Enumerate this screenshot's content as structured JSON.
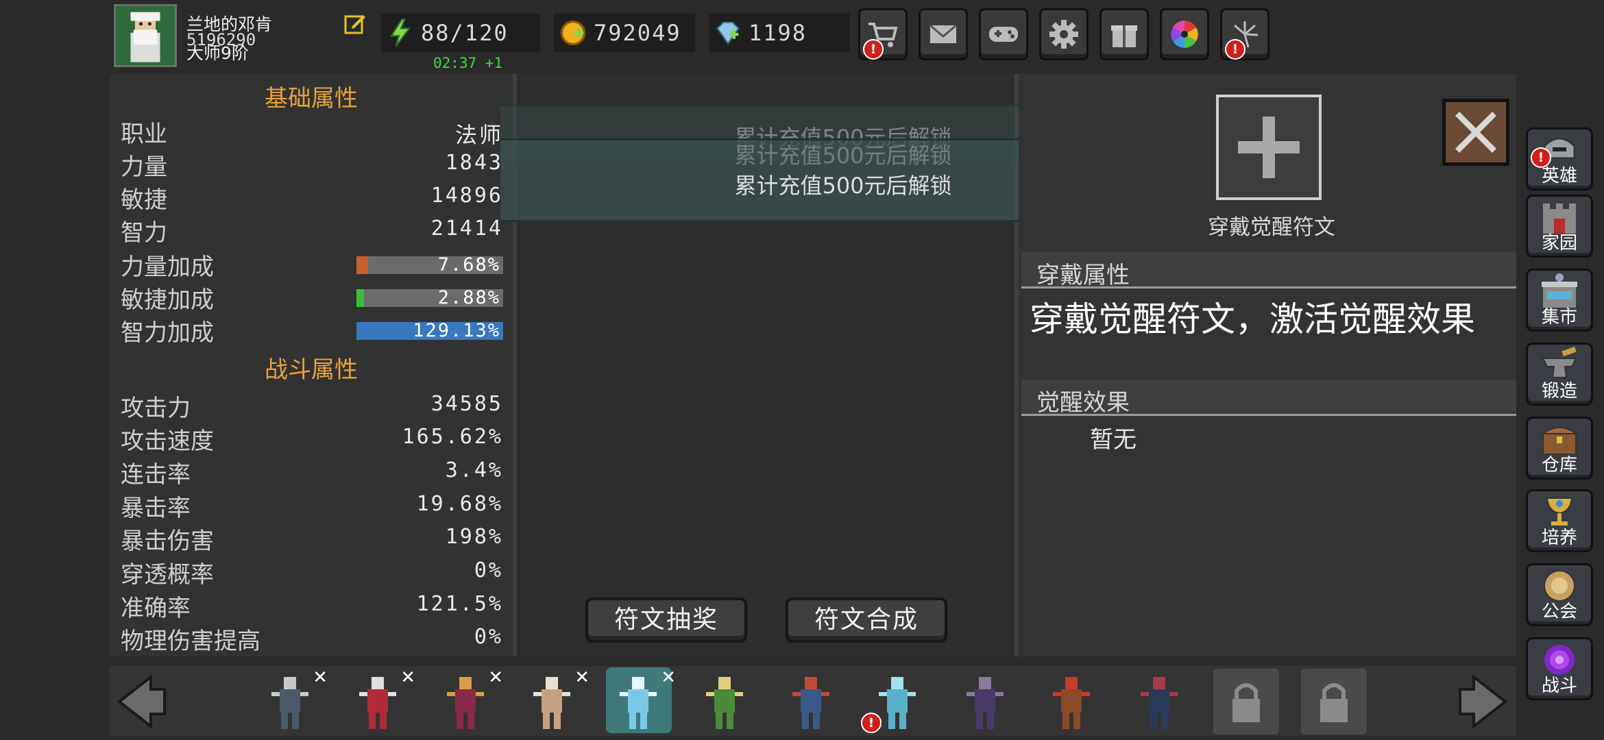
{
  "player": {
    "name": "兰地的邓肯",
    "id": "5196290",
    "rank": "大师9阶"
  },
  "resources": {
    "energy": "88/120",
    "energy_timer": "02:37 +1",
    "gold": "792049",
    "gems": "1198"
  },
  "top_buttons": [
    {
      "name": "shop",
      "icon": "cart-icon",
      "alert": "!"
    },
    {
      "name": "mail",
      "icon": "mail-icon"
    },
    {
      "name": "gamepad",
      "icon": "gamepad-icon"
    },
    {
      "name": "settings",
      "icon": "gear-icon"
    },
    {
      "name": "gift",
      "icon": "gift-icon"
    },
    {
      "name": "wheel",
      "icon": "color-wheel-icon"
    },
    {
      "name": "firework",
      "icon": "firework-icon",
      "alert": "!"
    }
  ],
  "base_attrs": {
    "title": "基础属性",
    "rows": [
      {
        "label": "职业",
        "value": "法师"
      },
      {
        "label": "力量",
        "value": "1843"
      },
      {
        "label": "敏捷",
        "value": "14896"
      },
      {
        "label": "智力",
        "value": "21414"
      }
    ],
    "bonus_rows": [
      {
        "label": "力量加成",
        "value": "7.68%",
        "fill": 0.08,
        "color": "#c8602c"
      },
      {
        "label": "敏捷加成",
        "value": "2.88%",
        "fill": 0.05,
        "color": "#34c234"
      },
      {
        "label": "智力加成",
        "value": "129.13%",
        "fill": 1.0,
        "color": "#3a78c0"
      }
    ]
  },
  "combat_attrs": {
    "title": "战斗属性",
    "rows": [
      {
        "label": "攻击力",
        "value": "34585"
      },
      {
        "label": "攻击速度",
        "value": "165.62%"
      },
      {
        "label": "连击率",
        "value": "3.4%"
      },
      {
        "label": "暴击率",
        "value": "19.68%"
      },
      {
        "label": "暴击伤害",
        "value": "198%"
      },
      {
        "label": "穿透概率",
        "value": "0%"
      },
      {
        "label": "准确率",
        "value": "121.5%"
      },
      {
        "label": "物理伤害提高",
        "value": "0%"
      }
    ]
  },
  "rune_panel": {
    "lock_text": "累计充值500元后解锁",
    "lottery_button": "符文抽奖",
    "synth_button": "符文合成"
  },
  "right_panel": {
    "slot_label": "穿戴觉醒符文",
    "equip_header": "穿戴属性",
    "equip_desc": "穿戴觉醒符文，激活觉醒效果",
    "awaken_header": "觉醒效果",
    "awaken_value": "暂无"
  },
  "sidebar": [
    {
      "label": "英雄",
      "icon": "helmet-icon",
      "alert": "!"
    },
    {
      "label": "家园",
      "icon": "castle-icon"
    },
    {
      "label": "集市",
      "icon": "market-icon"
    },
    {
      "label": "锻造",
      "icon": "anvil-icon"
    },
    {
      "label": "仓库",
      "icon": "chest-icon"
    },
    {
      "label": "培养",
      "icon": "chalice-icon"
    },
    {
      "label": "公会",
      "icon": "guild-icon"
    },
    {
      "label": "战斗",
      "icon": "portal-icon"
    }
  ],
  "heroes": {
    "count_visible": 11,
    "selected_index": 4,
    "marked": "✕",
    "alert": "!"
  }
}
